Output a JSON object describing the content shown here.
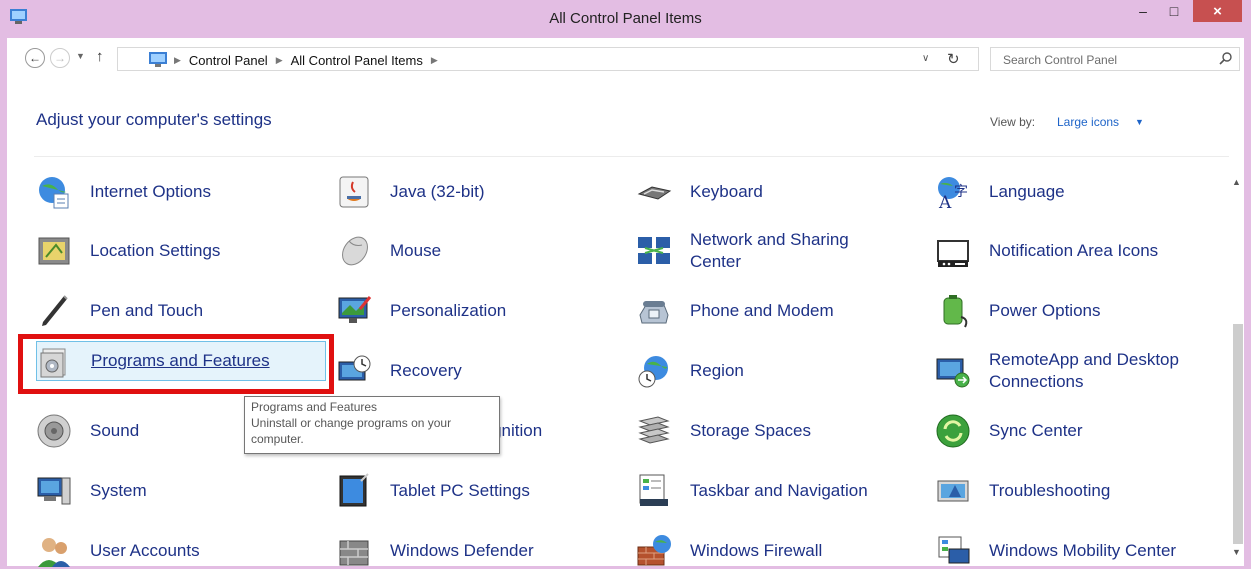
{
  "window": {
    "title": "All Control Panel Items",
    "minimize": "–",
    "maximize": "□",
    "close": "×"
  },
  "address": {
    "crumbs": [
      "Control Panel",
      "All Control Panel Items"
    ],
    "search_placeholder": "Search Control Panel"
  },
  "header": {
    "heading": "Adjust your computer's settings",
    "view_by_label": "View by:",
    "view_by_value": "Large icons"
  },
  "items": [
    [
      "Internet Options",
      "Java (32-bit)",
      "Keyboard",
      "Language"
    ],
    [
      "Location Settings",
      "Mouse",
      "Network and Sharing Center",
      "Notification Area Icons"
    ],
    [
      "Pen and Touch",
      "Personalization",
      "Phone and Modem",
      "Power Options"
    ],
    [
      "Programs and Features",
      "Recovery",
      "Region",
      "RemoteApp and Desktop Connections"
    ],
    [
      "Sound",
      "Speech Recognition",
      "Storage Spaces",
      "Sync Center"
    ],
    [
      "System",
      "Tablet PC Settings",
      "Taskbar and Navigation",
      "Troubleshooting"
    ],
    [
      "User Accounts",
      "Windows Defender",
      "Windows Firewall",
      "Windows Mobility Center"
    ]
  ],
  "item_labels": {
    "network_l1": "Network and Sharing",
    "network_l2": "Center",
    "remote_l1": "RemoteApp and Desktop",
    "remote_l2": "Connections"
  },
  "tooltip": {
    "title": "Programs and Features",
    "line1": "Uninstall or change programs on your",
    "line2": "computer."
  },
  "selected_item": "Programs and Features",
  "colors": {
    "titlebar": "#e3bde3",
    "link": "#1e3287",
    "highlight": "#e01010",
    "selection": "#e5f3fb"
  }
}
